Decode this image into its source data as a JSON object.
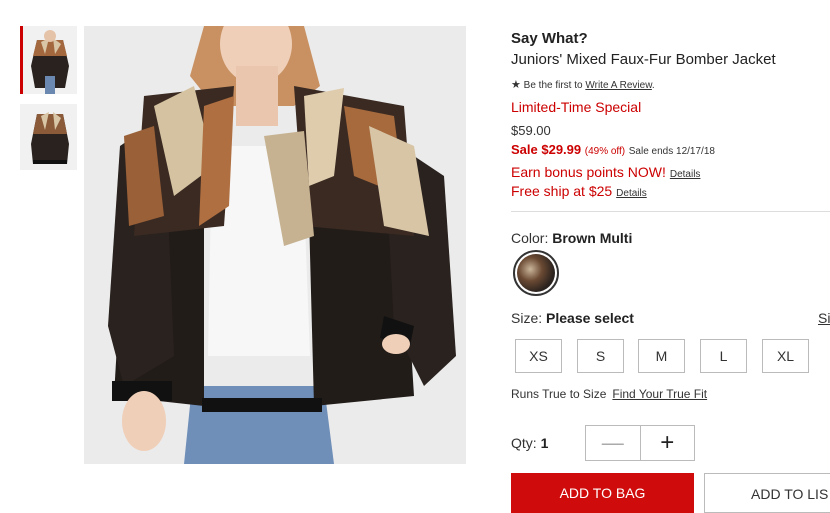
{
  "thumbnails": [
    {
      "alt": "product image 1",
      "active": true
    },
    {
      "alt": "product image 2",
      "active": false
    }
  ],
  "product": {
    "brand": "Say What?",
    "name": "Juniors' Mixed Faux-Fur Bomber Jacket",
    "review_prefix": "Be the first to",
    "review_link": "Write A Review",
    "review_suffix": ".",
    "promo": "Limited-Time Special",
    "original_price": "$59.00",
    "sale_price": "Sale $29.99",
    "sale_percent": "(49% off)",
    "sale_ends": "Sale ends 12/17/18",
    "bonus_text": "Earn bonus points NOW!",
    "bonus_details": "Details",
    "ship_text": "Free ship at $25",
    "ship_details": "Details"
  },
  "color": {
    "label": "Color:",
    "value": "Brown Multi"
  },
  "size": {
    "label": "Size:",
    "value": "Please select",
    "chart_link": "Si",
    "options": [
      "XS",
      "S",
      "M",
      "L",
      "XL"
    ]
  },
  "fit": {
    "text": "Runs True to Size",
    "link": "Find Your True Fit"
  },
  "quantity": {
    "label": "Qty:",
    "value": "1",
    "minus": "—",
    "plus": "+"
  },
  "actions": {
    "add_to_bag": "ADD TO BAG",
    "add_to_list": "ADD TO LIS"
  },
  "icons": {
    "star": "star-icon"
  },
  "colors": {
    "accent": "#cc0000",
    "button": "#d00b0b"
  }
}
